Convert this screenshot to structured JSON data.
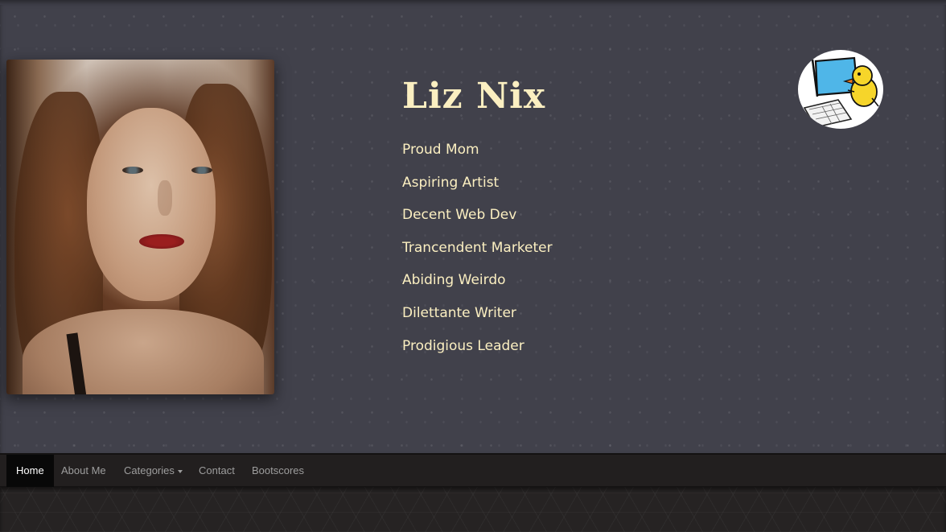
{
  "profile": {
    "name": "Liz Nix",
    "roles": [
      "Proud Mom",
      "Aspiring Artist",
      "Decent Web Dev",
      "Trancendent Marketer",
      "Abiding Weirdo",
      "Dilettante Writer",
      "Prodigious Leader"
    ]
  },
  "nav": {
    "items": [
      {
        "label": "Home",
        "active": true
      },
      {
        "label": "About Me"
      },
      {
        "label": "Categories",
        "has_dropdown": true
      },
      {
        "label": "Contact"
      },
      {
        "label": "Bootscores"
      }
    ]
  },
  "colors": {
    "hero_bg": "#41414b",
    "accent_text": "#fbefc1",
    "navbar_bg": "#221f1f",
    "nav_active_bg": "#080808",
    "nav_text": "#9d9d9d"
  },
  "icons": {
    "logo": "duck-at-computer-logo",
    "dropdown": "caret-down-icon"
  }
}
